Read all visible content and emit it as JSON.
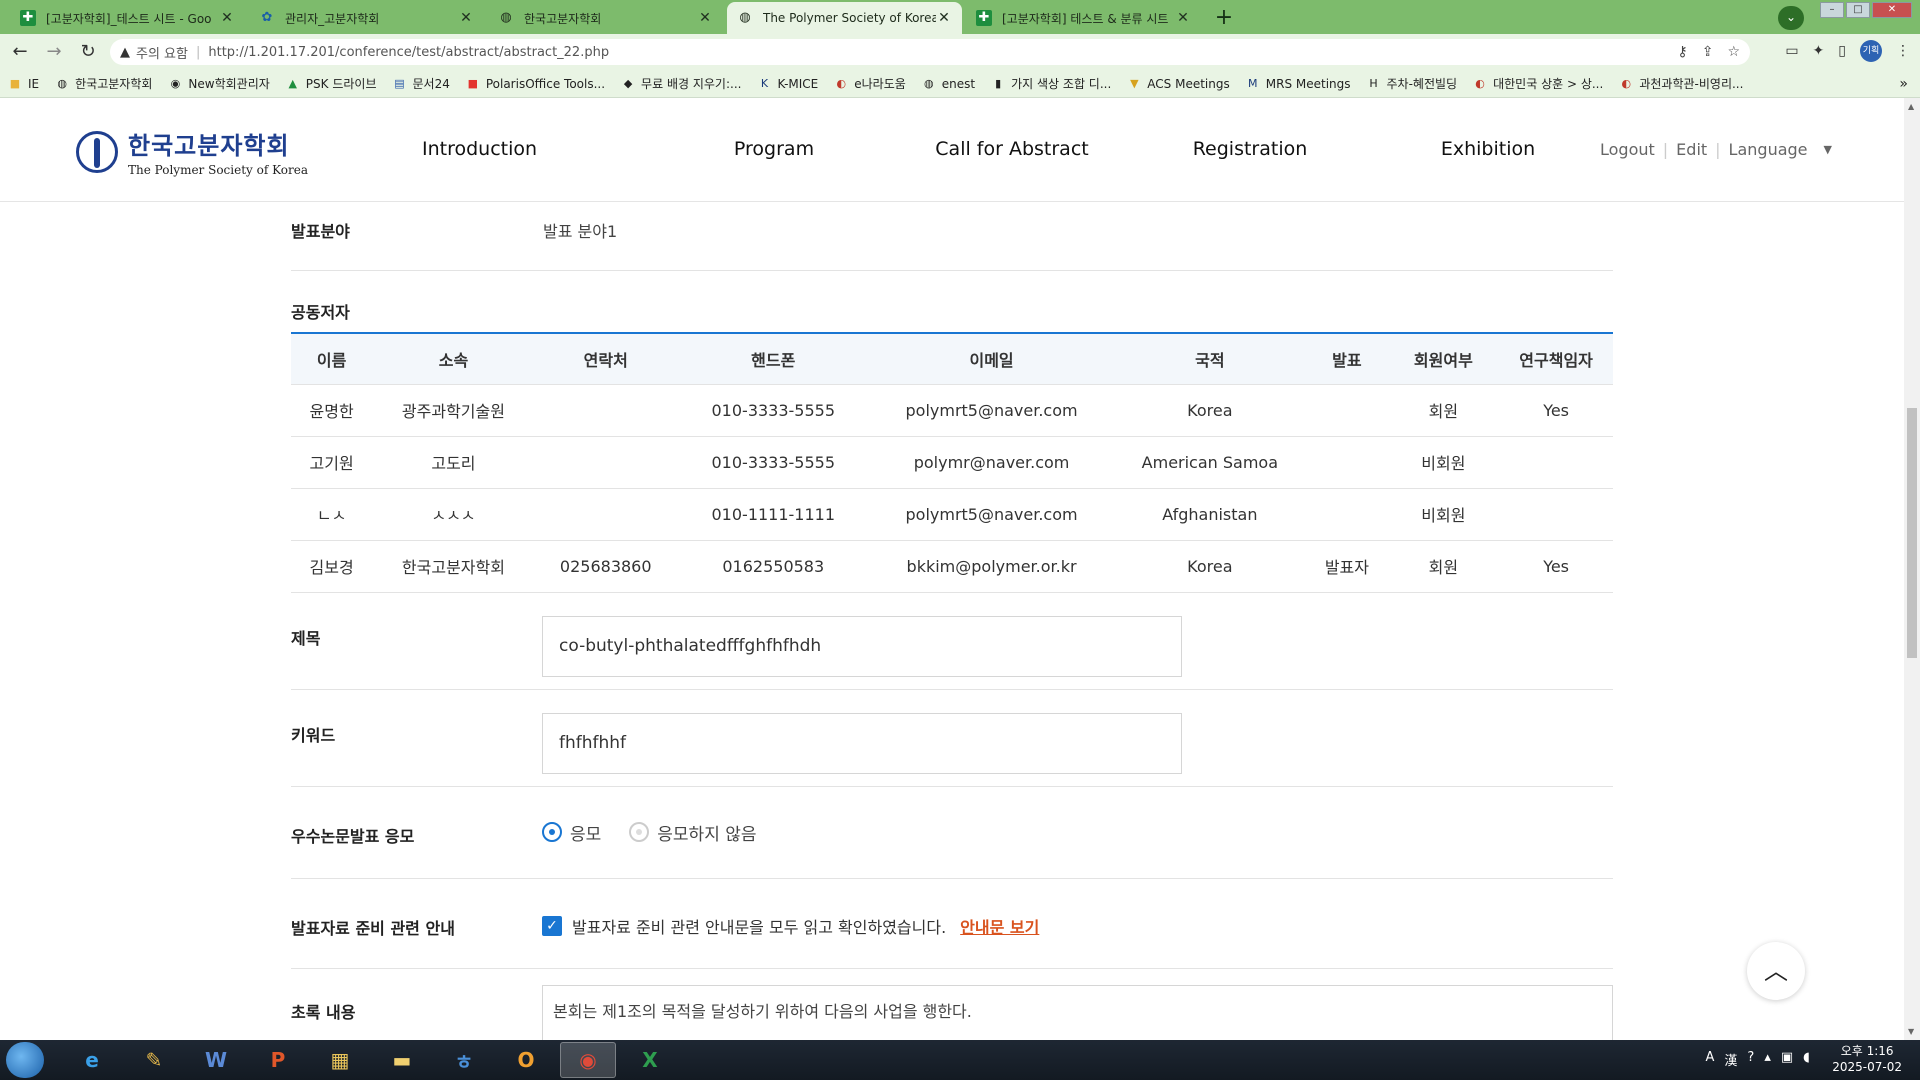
{
  "browser": {
    "tabs": [
      {
        "title": "[고분자학회]_테스트 시트 - Goo",
        "icon": "sheets-icon",
        "color": "#1e8e3e"
      },
      {
        "title": "관리자_고분자학회",
        "icon": "admin-icon",
        "color": "#1a5fa8"
      },
      {
        "title": "한국고분자학회",
        "icon": "globe-icon",
        "color": "#555555"
      },
      {
        "title": "The Polymer Society of Korea",
        "icon": "globe-icon",
        "color": "#555555"
      },
      {
        "title": "[고분자학회] 테스트 & 분류 시트",
        "icon": "sheets-icon",
        "color": "#1e8e3e"
      }
    ],
    "active_tab_index": 3,
    "address": {
      "security_label": "주의 요함",
      "url": "http://1.201.17.201/conference/test/abstract/abstract_22.php"
    },
    "profile_initials": "기획",
    "bookmarks": [
      {
        "label": "IE",
        "icon": "folder-icon"
      },
      {
        "label": "한국고분자학회",
        "icon": "globe-icon"
      },
      {
        "label": "New학회관리자",
        "icon": "globe-icon"
      },
      {
        "label": "PSK 드라이브",
        "icon": "drive-icon"
      },
      {
        "label": "문서24",
        "icon": "doc-icon"
      },
      {
        "label": "PolarisOffice Tools...",
        "icon": "polaris-icon"
      },
      {
        "label": "무료 배경 지우기:...",
        "icon": "bg-remove-icon"
      },
      {
        "label": "K-MICE",
        "icon": "kmice-icon"
      },
      {
        "label": "e나라도움",
        "icon": "gov-icon"
      },
      {
        "label": "enest",
        "icon": "globe-icon"
      },
      {
        "label": "가지 색상 조합 디...",
        "icon": "palette-icon"
      },
      {
        "label": "ACS Meetings",
        "icon": "acs-icon"
      },
      {
        "label": "MRS Meetings",
        "icon": "mrs-icon"
      },
      {
        "label": "주차-혜전빌딩",
        "icon": "parking-icon"
      },
      {
        "label": "대한민국 상훈 > 상...",
        "icon": "gov-icon"
      },
      {
        "label": "과천과학관-비영리...",
        "icon": "gov-icon"
      }
    ]
  },
  "site": {
    "logo_ko": "한국고분자학회",
    "logo_en": "The Polymer Society of Korea",
    "nav": [
      "Introduction",
      "Program",
      "Call for Abstract",
      "Registration",
      "Exhibition"
    ],
    "util": {
      "logout": "Logout",
      "edit": "Edit",
      "language": "Language"
    }
  },
  "form": {
    "field_label": "발표분야",
    "field_value": "발표 분야1",
    "coauthors_label": "공동저자",
    "coauthor_headers": [
      "이름",
      "소속",
      "연락처",
      "핸드폰",
      "이메일",
      "국적",
      "발표",
      "회원여부",
      "연구책임자"
    ],
    "coauthors": [
      [
        "윤명한",
        "광주과학기술원",
        "",
        "010-3333-5555",
        "polymrt5@naver.com",
        "Korea",
        "",
        "회원",
        "Yes"
      ],
      [
        "고기원",
        "고도리",
        "",
        "010-3333-5555",
        "polymr@naver.com",
        "American Samoa",
        "",
        "비회원",
        ""
      ],
      [
        "ㄴㅅ",
        "ㅅㅅㅅ",
        "",
        "010-1111-1111",
        "polymrt5@naver.com",
        "Afghanistan",
        "",
        "비회원",
        ""
      ],
      [
        "김보경",
        "한국고분자학회",
        "025683860",
        "0162550583",
        "bkkim@polymer.or.kr",
        "Korea",
        "발표자",
        "회원",
        "Yes"
      ]
    ],
    "title_label": "제목",
    "title_value": "co-butyl-phthalatedfffghfhfhdh",
    "keyword_label": "키워드",
    "keyword_value": "fhfhfhhf",
    "award_label": "우수논문발표 응모",
    "award_options": [
      "응모",
      "응모하지 않음"
    ],
    "award_selected": "응모",
    "guide_label": "발표자료 준비 관련 안내",
    "guide_check_text": "발표자료 준비 관련 안내문을 모두 읽고 확인하였습니다.",
    "guide_checked": true,
    "guide_link": "안내문 보기",
    "abstract_label": "초록 내용",
    "abstract_preview": "본회는 제1조의 목적을 달성하기 위하여 다음의 사업을 행한다."
  },
  "taskbar": {
    "apps": [
      "ie-icon",
      "paint-icon",
      "word-icon",
      "powerpoint-icon",
      "explorer-icon",
      "folder-icon",
      "hwp-icon",
      "outlook-icon",
      "chrome-icon",
      "excel-icon"
    ],
    "active_app": "chrome-icon",
    "clock_time": "오후 1:16",
    "clock_date": "2025-07-02"
  },
  "colors": {
    "accent": "#1976d2",
    "link": "#d9531e",
    "tabstrip": "#7dbb6c",
    "logo": "#1f3f8f"
  }
}
